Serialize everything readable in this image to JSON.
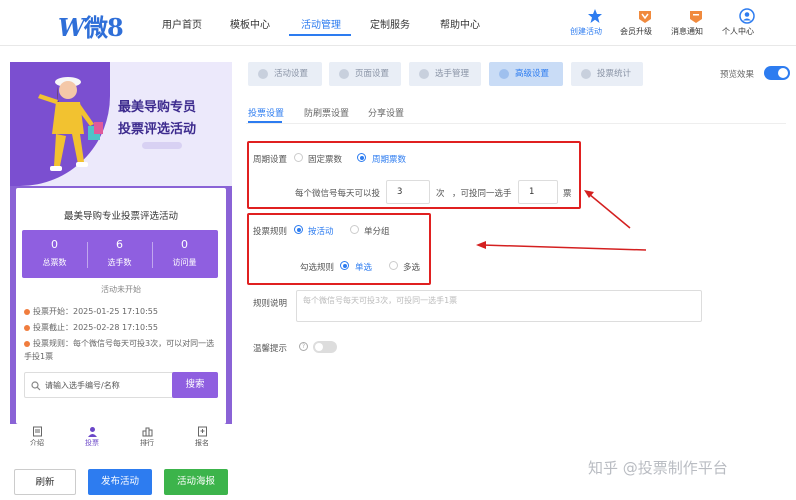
{
  "brand": {
    "logo_w": "W",
    "logo_text": "微8"
  },
  "nav": {
    "items": [
      "用户首页",
      "模板中心",
      "活动管理",
      "定制服务",
      "帮助中心"
    ],
    "active": "活动管理"
  },
  "tools": [
    {
      "label": "创建活动",
      "icon": "star-icon",
      "color": "#2d7cf0"
    },
    {
      "label": "会员升级",
      "icon": "vip-icon",
      "color": "#f08a3e"
    },
    {
      "label": "消息通知",
      "icon": "message-icon",
      "color": "#f08a3e"
    },
    {
      "label": "个人中心",
      "icon": "user-icon",
      "color": "#2d7cf0"
    }
  ],
  "phone": {
    "banner_title_1": "最美导购专员",
    "banner_title_2": "投票评选活动",
    "card_title": "最美导购专业投票评选活动",
    "stats": [
      {
        "value": "0",
        "label": "总票数"
      },
      {
        "value": "6",
        "label": "选手数"
      },
      {
        "value": "0",
        "label": "访问量"
      }
    ],
    "status": "活动未开始",
    "info": [
      "投票开始：2025-01-25 17:10:55",
      "投票截止：2025-02-28 17:10:55",
      "投票规则：每个微信号每天可投3次，可以对同一选手投1票"
    ],
    "search_placeholder": "请输入选手编号/名称",
    "search_button": "搜索",
    "tabbar": [
      "介绍",
      "投票",
      "排行",
      "报名"
    ]
  },
  "actions": {
    "refresh": "刷新",
    "publish": "发布活动",
    "poster": "活动海报"
  },
  "steps": [
    "活动设置",
    "页面设置",
    "选手管理",
    "高级设置",
    "投票统计"
  ],
  "active_step": "高级设置",
  "preview_label": "预览效果",
  "subtabs": [
    "投票设置",
    "防刷票设置",
    "分享设置"
  ],
  "period": {
    "label": "周期设置",
    "options": [
      "固定票数",
      "周期票数"
    ],
    "selected": "周期票数",
    "sentence_1": "每个微信号每天可以投",
    "count_1": "3",
    "unit_1": "次",
    "sentence_2": "，可投同一选手",
    "count_2": "1",
    "unit_2": "票"
  },
  "rules": {
    "label": "投票规则",
    "options": [
      "按活动",
      "单分组"
    ],
    "selected": "按活动",
    "check_label": "勾选规则",
    "check_options": [
      "单选",
      "多选"
    ],
    "check_selected": "单选"
  },
  "description": {
    "label": "规则说明",
    "placeholder": "每个微信号每天可投3次，可投同一选手1票"
  },
  "tip": {
    "label": "温馨提示"
  },
  "watermark": "知乎 @投票制作平台"
}
